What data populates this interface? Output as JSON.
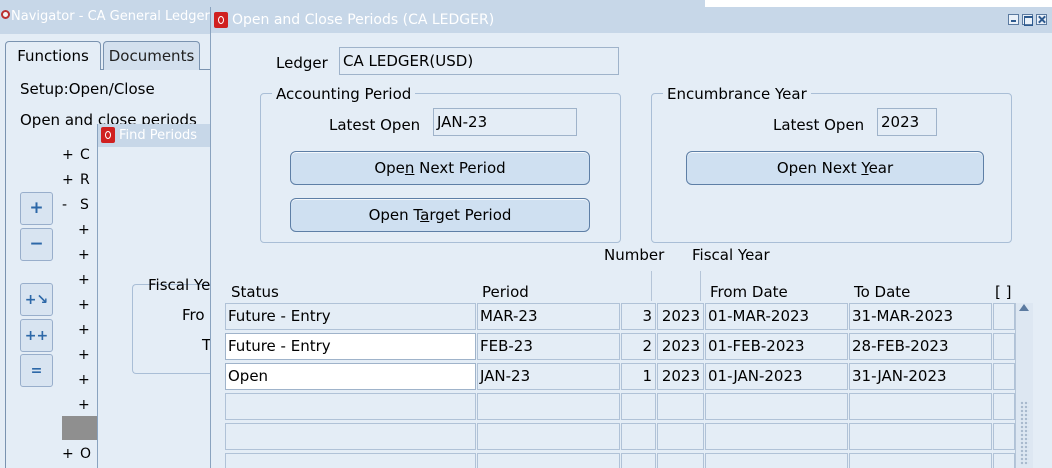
{
  "navigator": {
    "title": "Navigator - CA General Ledger",
    "tabs": [
      "Functions",
      "Documents"
    ],
    "setup_text": "Setup:Open/Close",
    "open_text": "Open and close periods",
    "tree_rows": [
      {
        "toggle": "+",
        "text": "C"
      },
      {
        "toggle": "+",
        "text": "R"
      },
      {
        "toggle": "-",
        "text": "S"
      },
      {
        "toggle": "+",
        "text": ""
      },
      {
        "toggle": "+",
        "text": ""
      },
      {
        "toggle": "+",
        "text": ""
      },
      {
        "toggle": "+",
        "text": ""
      },
      {
        "toggle": "+",
        "text": ""
      },
      {
        "toggle": "+",
        "text": ""
      },
      {
        "toggle": "+",
        "text": ""
      },
      {
        "toggle": "+",
        "text": ""
      }
    ],
    "tree_last": {
      "toggle": "+",
      "text": "O"
    },
    "side_buttons": [
      "expand-icon",
      "collapse-icon",
      "expand-branch-icon",
      "expand-all-icon",
      "collapse-all-icon"
    ]
  },
  "find_periods": {
    "title": "Find Periods",
    "labels": {
      "fiscal_year": "Fiscal Ye",
      "from": "Fro",
      "to": "T"
    }
  },
  "open_close": {
    "title": "Open and Close Periods (CA LEDGER)",
    "ledger_label": "Ledger",
    "ledger_value": "CA LEDGER(USD)",
    "accounting_period": {
      "title": "Accounting Period",
      "latest_open_label": "Latest Open",
      "latest_open_value": "JAN-23",
      "open_next_period_pre": "Ope",
      "open_next_period_key": "n",
      "open_next_period_post": " Next Period",
      "open_target_period_pre": "Open T",
      "open_target_period_key": "a",
      "open_target_period_post": "rget Period"
    },
    "encumbrance_year": {
      "title": "Encumbrance Year",
      "latest_open_label": "Latest Open",
      "latest_open_value": "2023",
      "open_next_year_pre": "Open Next ",
      "open_next_year_key": "Y",
      "open_next_year_post": "ear"
    },
    "table": {
      "header_number": "Number",
      "header_fiscal_year": "Fiscal Year",
      "columns": {
        "status": "Status",
        "period": "Period",
        "from_date": "From Date",
        "to_date": "To Date",
        "folder": "[ ]"
      },
      "rows": [
        {
          "status": "Future - Entry",
          "period": "MAR-23",
          "number": "3",
          "fiscal_year": "2023",
          "from_date": "01-MAR-2023",
          "to_date": "31-MAR-2023"
        },
        {
          "status": "Future - Entry",
          "period": "FEB-23",
          "number": "2",
          "fiscal_year": "2023",
          "from_date": "01-FEB-2023",
          "to_date": "28-FEB-2023"
        },
        {
          "status": "Open",
          "period": "JAN-23",
          "number": "1",
          "fiscal_year": "2023",
          "from_date": "01-JAN-2023",
          "to_date": "31-JAN-2023"
        },
        {
          "status": "",
          "period": "",
          "number": "",
          "fiscal_year": "",
          "from_date": "",
          "to_date": ""
        },
        {
          "status": "",
          "period": "",
          "number": "",
          "fiscal_year": "",
          "from_date": "",
          "to_date": ""
        },
        {
          "status": "",
          "period": "",
          "number": "",
          "fiscal_year": "",
          "from_date": "",
          "to_date": ""
        }
      ]
    }
  },
  "colors": {
    "window_bg": "#e4edf6",
    "title_bar": "#c7d7e8",
    "button_bg": "#cfe0f1",
    "logo_red": "#d02020"
  }
}
